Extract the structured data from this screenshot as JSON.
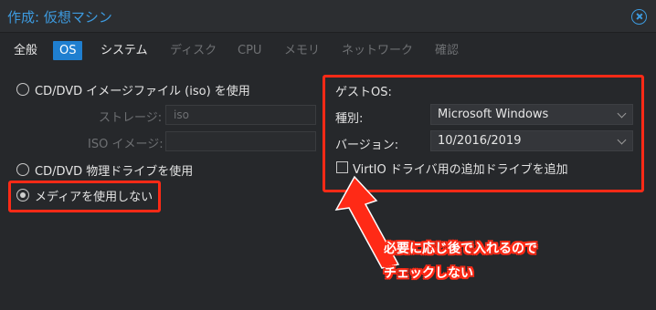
{
  "window": {
    "title": "作成: 仮想マシン"
  },
  "tabs": [
    {
      "label": "全般"
    },
    {
      "label": "OS"
    },
    {
      "label": "システム"
    },
    {
      "label": "ディスク"
    },
    {
      "label": "CPU"
    },
    {
      "label": "メモリ"
    },
    {
      "label": "ネットワーク"
    },
    {
      "label": "確認"
    }
  ],
  "media": {
    "iso_option": "CD/DVD イメージファイル (iso) を使用",
    "storage_label": "ストレージ:",
    "storage_value": "iso",
    "iso_image_label": "ISO イメージ:",
    "physical_option": "CD/DVD 物理ドライブを使用",
    "no_media_option": "メディアを使用しない"
  },
  "guest": {
    "heading": "ゲストOS:",
    "type_label": "種別:",
    "type_value": "Microsoft Windows",
    "version_label": "バージョン:",
    "version_value": "10/2016/2019",
    "virtio_label": "VirtIO ドライバ用の追加ドライブを追加"
  },
  "annotation": {
    "line1": "必要に応じ後で入れるので",
    "line2": "チェックしない",
    "color": "#ff2a16"
  },
  "colors": {
    "accent": "#1f7fd0",
    "title": "#3d9be0"
  }
}
